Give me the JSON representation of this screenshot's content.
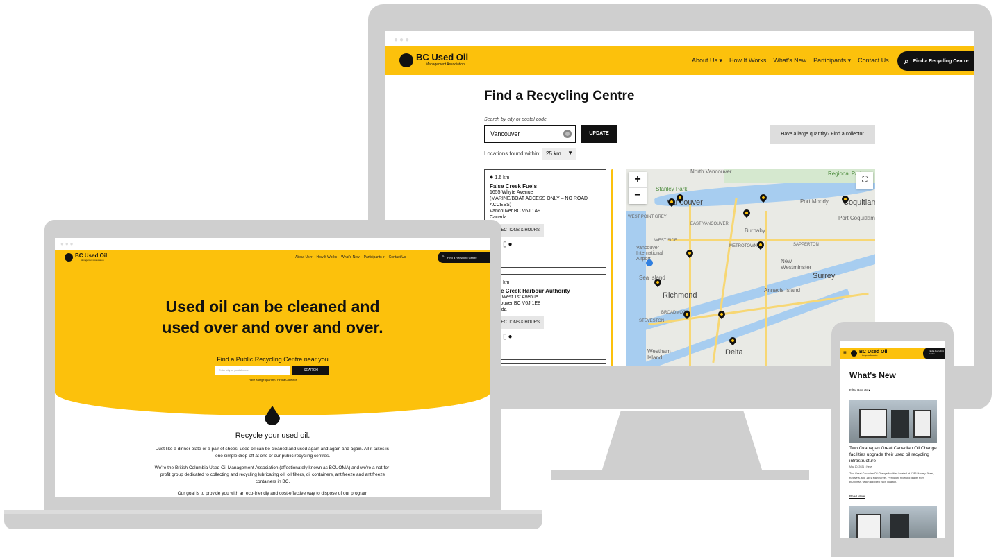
{
  "brand": {
    "name": "BC Used Oil",
    "tagline": "Management Association"
  },
  "desktop": {
    "nav": [
      "About Us ▾",
      "How It Works",
      "What's New",
      "Participants ▾",
      "Contact Us"
    ],
    "cta": "Find a Recycling Centre",
    "page_title": "Find a Recycling Centre",
    "search_label": "Search by city or postal code.",
    "search_value": "Vancouver",
    "update_label": "UPDATE",
    "collector_label": "Have a large quantity? Find a collector",
    "within_label": "Locations found within:",
    "within_value": "25 km",
    "results": [
      {
        "distance": "1.6 km",
        "name": "False Creek Fuels",
        "line1": "1655 Whyte Avenue",
        "line2": "(MARINE/BOAT ACCESS ONLY – NO ROAD ACCESS)",
        "line3": "Vancouver BC V6J 1A9",
        "line4": "Canada",
        "button": "DIRECTIONS & HOURS"
      },
      {
        "distance": "1.7 km",
        "name": "False Creek Harbour Authority",
        "line1": "1505 West 1st Avenue",
        "line2": "",
        "line3": "Vancouver BC V6J 1E8",
        "line4": "Canada",
        "button": "DIRECTIONS & HOURS"
      }
    ],
    "map": {
      "zoom_in": "+",
      "zoom_out": "−",
      "labels": [
        "North Vancouver",
        "Regional Park",
        "Stanley Park",
        "Vancouver",
        "WEST POINT GREY",
        "EAST VANCOUVER",
        "Burnaby",
        "Port Moody",
        "Coquitlam",
        "Port Coquitlam",
        "WEST SIDE",
        "METROTOWN",
        "SAPPERTON",
        "Vancouver International Airport",
        "New Westminster",
        "Sea Island",
        "Richmond",
        "Annacis Island",
        "Surrey",
        "BROADMOOR",
        "STEVESTON",
        "Delta",
        "Westham Island"
      ]
    }
  },
  "laptop": {
    "nav": [
      "About Us ▾",
      "How It Works",
      "What's New",
      "Participants ▾",
      "Contact Us"
    ],
    "cta": "Find a Recycling Centre",
    "headline1": "Used oil can be cleaned and",
    "headline2": "used over and over and over.",
    "find_label": "Find a Public Recycling Centre near you",
    "search_placeholder": "Enter city or postal code",
    "search_button": "SEARCH",
    "collector_prefix": "Have a large quantity? ",
    "collector_link": "Find a Collector",
    "section_title": "Recycle your used oil.",
    "para1": "Just like a dinner plate or a pair of shoes, used oil can be cleaned and used again and again and again. All it takes is one simple drop-off at one of our public recycling centres.",
    "para2": "We're the British Columbia Used Oil Management Association (affectionately known as BCUOMA) and we're a not-for-profit group dedicated to collecting and recycling lubricating oil, oil filters, oil containers, antifreeze and antifreeze containers in BC.",
    "para3": "Our goal is to provide you with an eco-friendly and cost-effective way to dispose of our program"
  },
  "phone": {
    "cta": "Find a Recycling Centre",
    "title": "What's New",
    "filter": "Filter Results ▾",
    "article_title": "Two Okanagan Great Canadian Oil Change facilities upgrade their used oil recycling infrastructure",
    "article_meta": "May 10, 2021 • News",
    "article_body": "Two Great Canadian Oil Change facilities located at 1785 Harvey Street, Kelowna, and 1801 Main Street, Penticton, received grants from BCUOMA, which supplied each location.",
    "read_more": "Read More"
  },
  "colors": {
    "brand_yellow": "#fcc10c",
    "dark": "#111111",
    "device_gray": "#cfcfcf"
  }
}
